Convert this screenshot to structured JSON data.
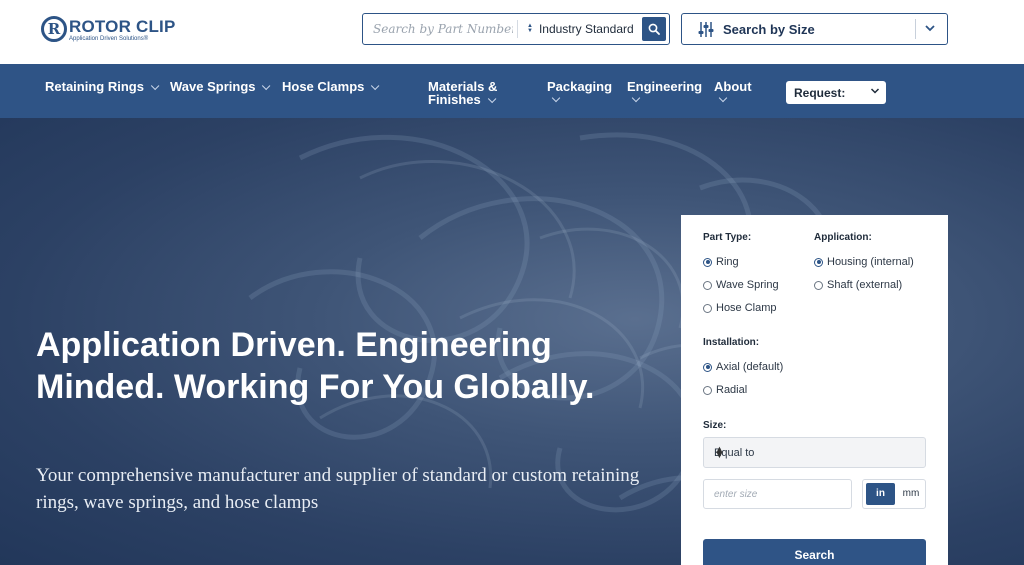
{
  "brand": {
    "badge": "R",
    "name": "ROTOR CLIP",
    "tagline": "Application Driven Solutions®",
    "color": "#2d5486"
  },
  "header": {
    "part_search": {
      "placeholder": "Search by Part Number",
      "standard_selected": "Industry Standard",
      "search_icon": "search-icon"
    },
    "size_search": {
      "label": "Search by Size",
      "icon": "sliders-icon",
      "chevron": "chevron-down-icon"
    }
  },
  "nav": {
    "items": [
      {
        "label": "Retaining Rings"
      },
      {
        "label": "Wave Springs"
      },
      {
        "label": "Hose Clamps"
      },
      {
        "label_line1": "Materials &",
        "label_line2": "Finishes"
      },
      {
        "label": "Packaging"
      },
      {
        "label": "Engineering"
      },
      {
        "label": "About"
      }
    ],
    "request": {
      "label": "Request:"
    },
    "background": "#2f5486"
  },
  "hero": {
    "title": "Application Driven. Engineering Minded. Working For You Globally.",
    "subtitle": "Your comprehensive manufacturer and supplier of standard or custom retaining rings, wave springs, and hose clamps"
  },
  "finder": {
    "part_type": {
      "label": "Part Type:",
      "options": [
        {
          "label": "Ring",
          "selected": true
        },
        {
          "label": "Wave Spring",
          "selected": false
        },
        {
          "label": "Hose Clamp",
          "selected": false
        }
      ]
    },
    "application": {
      "label": "Application:",
      "options": [
        {
          "label": "Housing (internal)",
          "selected": true
        },
        {
          "label": "Shaft (external)",
          "selected": false
        }
      ]
    },
    "installation": {
      "label": "Installation:",
      "options": [
        {
          "label": "Axial (default)",
          "selected": true
        },
        {
          "label": "Radial",
          "selected": false
        }
      ]
    },
    "size": {
      "label": "Size:",
      "comparator": "Equal to",
      "placeholder": "enter size",
      "unit_in": "in",
      "unit_mm": "mm",
      "unit_selected": "in"
    },
    "submit": "Search"
  }
}
